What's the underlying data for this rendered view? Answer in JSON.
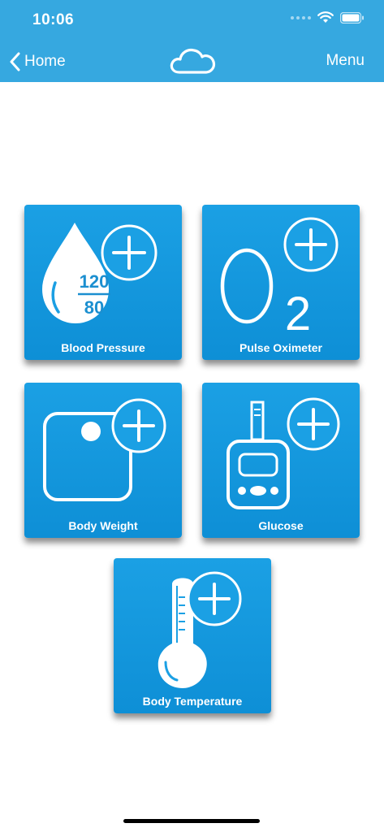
{
  "status_bar": {
    "time": "10:06"
  },
  "nav": {
    "back_label": "Home",
    "menu_label": "Menu"
  },
  "colors": {
    "accent": "#36a8e0",
    "tile_top": "#1ba0e4",
    "tile_bottom": "#0e8fd6"
  },
  "tiles": [
    {
      "label": "Blood Pressure",
      "icon": "blood-drop-icon",
      "reading_top": "120",
      "reading_bottom": "80"
    },
    {
      "label": "Pulse Oximeter",
      "icon": "o2-icon",
      "symbol": "O",
      "subscript": "2"
    },
    {
      "label": "Body Weight",
      "icon": "scale-icon"
    },
    {
      "label": "Glucose",
      "icon": "glucose-meter-icon"
    },
    {
      "label": "Body Temperature",
      "icon": "thermometer-icon"
    }
  ]
}
